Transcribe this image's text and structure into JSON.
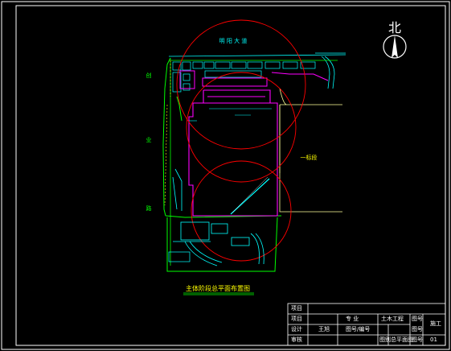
{
  "drawing": {
    "north_label": "北",
    "road_top": "明 阳 大 道",
    "road_left": [
      "创",
      "业",
      "路"
    ],
    "neighbor_label": "一标段",
    "plan_title": "主体阶段总平面布置图"
  },
  "title_block": {
    "r1_label": "项目",
    "r2_label": "项目",
    "r2_field": "专 业",
    "r2_value": "土木工程",
    "r3_label": "设计",
    "r3_value": "王旭",
    "r3_field": "图号/编号",
    "r4_label": "审核",
    "r4_field": "图别",
    "r4_value": "总平面图",
    "r4_field2": "图号",
    "r4_value2": "01",
    "scale_label": "图号",
    "scale_value": "施工",
    "extra_label": "图号"
  },
  "colors": {
    "background": "#000000",
    "frame": "#ffffff",
    "site_green": "#00ff00",
    "building_magenta": "#ff00ff",
    "crane_radius_red": "#ff0000",
    "road_cyan": "#00ffff",
    "adjacent_yellow": "#ffff99",
    "text_yellow": "#ffff00"
  }
}
